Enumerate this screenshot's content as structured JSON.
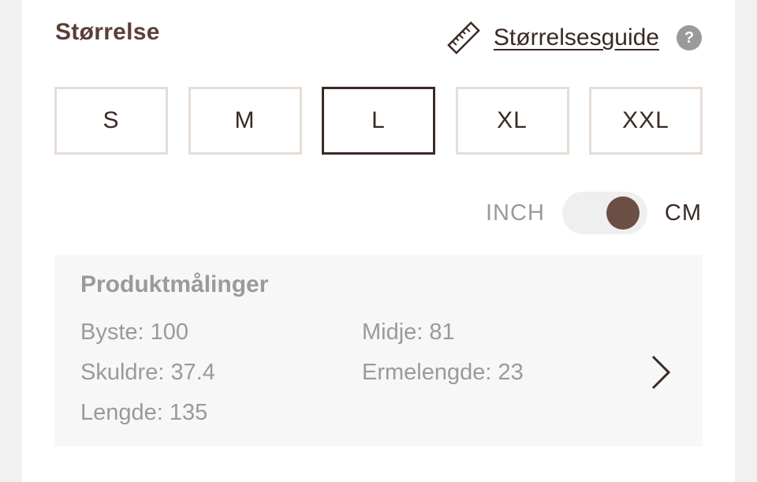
{
  "size_section": {
    "heading": "Størrelse",
    "guide_link": "Størrelsesguide",
    "help_glyph": "?",
    "icons": {
      "ruler": "ruler-icon",
      "help": "question-circle-icon",
      "chevron": "chevron-right-icon"
    },
    "sizes": [
      {
        "label": "S",
        "selected": false
      },
      {
        "label": "M",
        "selected": false
      },
      {
        "label": "L",
        "selected": true
      },
      {
        "label": "XL",
        "selected": false
      },
      {
        "label": "XXL",
        "selected": false
      }
    ],
    "selected_size": "L"
  },
  "unit_toggle": {
    "left_label": "INCH",
    "right_label": "CM",
    "active_unit": "CM"
  },
  "measurements": {
    "title": "Produktmålinger",
    "items": [
      {
        "text": "Byste: 100"
      },
      {
        "text": "Midje: 81"
      },
      {
        "text": "Skuldre: 37.4"
      },
      {
        "text": "Ermelengde: 23"
      },
      {
        "text": "Lengde: 135"
      }
    ]
  },
  "colors": {
    "brand_brown": "#5a3f36",
    "toggle_knob": "#6b4f44",
    "muted_text": "#9a9a9a",
    "selected_border": "#3a2a25",
    "default_border": "#e6ddd5"
  }
}
